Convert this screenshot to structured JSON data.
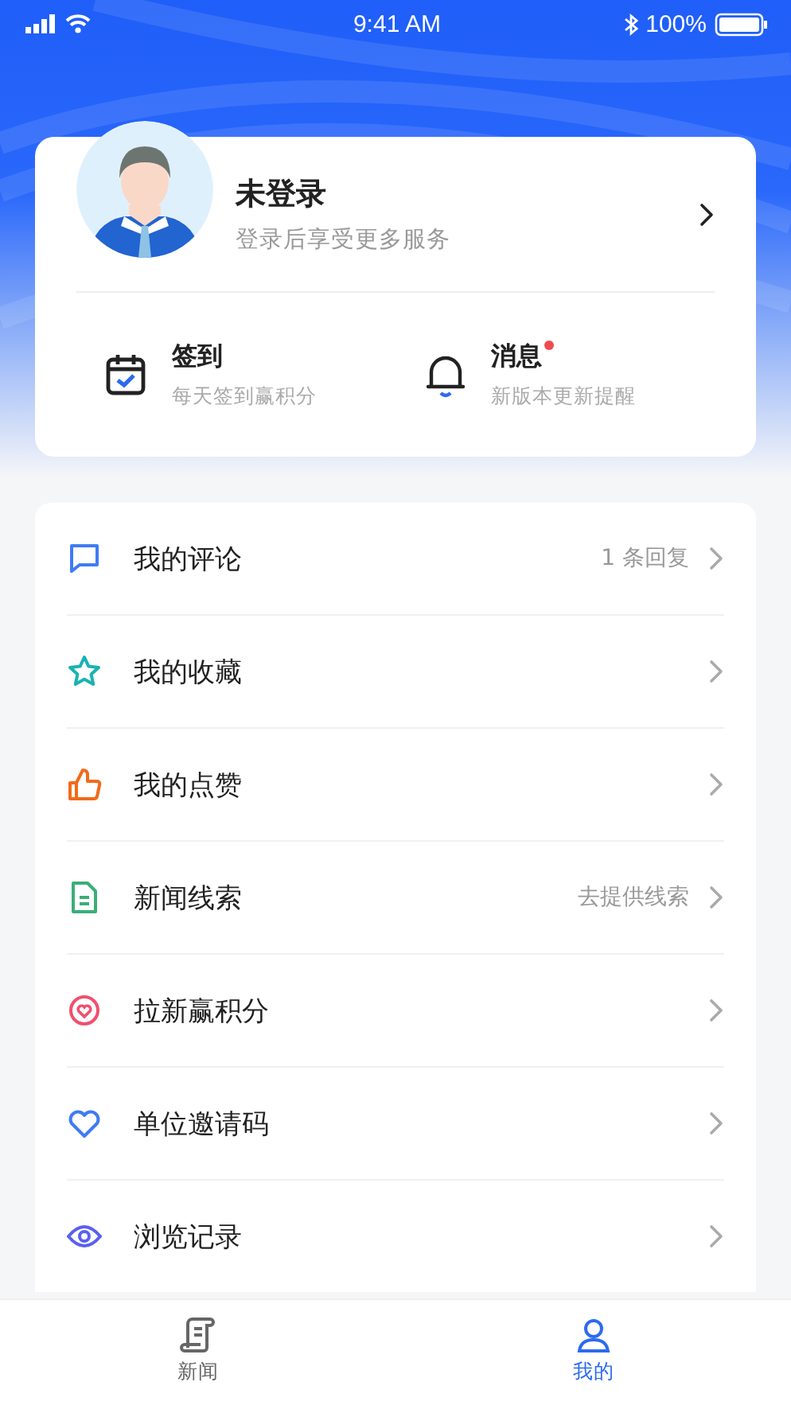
{
  "status_bar": {
    "time": "9:41 AM",
    "battery": "100%"
  },
  "profile": {
    "name": "未登录",
    "subtitle": "登录后享受更多服务"
  },
  "quick_actions": [
    {
      "kind": "checkin",
      "title": "签到",
      "subtitle": "每天签到赢积分",
      "unread": false
    },
    {
      "kind": "messages",
      "title": "消息",
      "subtitle": "新版本更新提醒",
      "unread": true
    }
  ],
  "menu": [
    {
      "kind": "comment",
      "label": "我的评论",
      "detail": "1 条回复"
    },
    {
      "kind": "star",
      "label": "我的收藏"
    },
    {
      "kind": "like",
      "label": "我的点赞"
    },
    {
      "kind": "doc",
      "label": "新闻线索",
      "detail": "去提供线索"
    },
    {
      "kind": "invite",
      "label": "拉新赢积分"
    },
    {
      "kind": "heart",
      "label": "单位邀请码"
    },
    {
      "kind": "eye",
      "label": "浏览记录"
    }
  ],
  "tab_bar": [
    {
      "kind": "news",
      "label": "新闻",
      "selected": false
    },
    {
      "kind": "me",
      "label": "我的",
      "selected": true
    }
  ]
}
